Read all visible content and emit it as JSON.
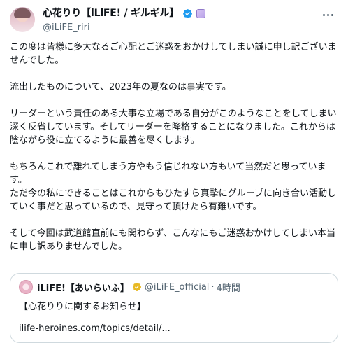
{
  "author": {
    "display_name": "心花りり【iLiFE! / ギルギル】",
    "handle": "@iLiFE_riri",
    "avatar_icon": "user-avatar",
    "verified_icon": "verified-badge-icon",
    "affiliate_icon": "affiliate-badge-icon",
    "verified_color": "#1d9bf0"
  },
  "more_icon": "more-options-icon",
  "body": {
    "p1": "この度は皆様に多大なるご心配とご迷惑をおかけしてしまい誠に申し訳ございませんでした。",
    "p2": "流出したものについて、2023年の夏なのは事実です。",
    "p3": "リーダーという責任のある大事な立場である自分がこのようなことをしてしまい深く反省しています。そしてリーダーを降格することになりました。これからは陰ながら役に立てるように最善を尽くします。",
    "p4a": "もちろんこれで離れてしまう方やもう信じれない方もいて当然だと思っています。",
    "p4b": "ただ今の私にできることはこれからもひたすら真摯にグループに向き合い活動していく事だと思っているので、見守って頂けたら有難いです。",
    "p5": "そして今回は武道館直前にも関わらず、こんなにもご迷惑おかけしてしまい本当に申し訳ありませんでした。"
  },
  "quote": {
    "display_name": "iLiFE!【あいらいふ】",
    "handle": "@iLiFE_official",
    "separator": "·",
    "time": "4時間",
    "text": "【心花りりに関するお知らせ】",
    "link": "ilife-heroines.com/topics/detail/...",
    "badge_color": "#e8b923",
    "badge_icon": "gold-verified-badge-icon"
  }
}
